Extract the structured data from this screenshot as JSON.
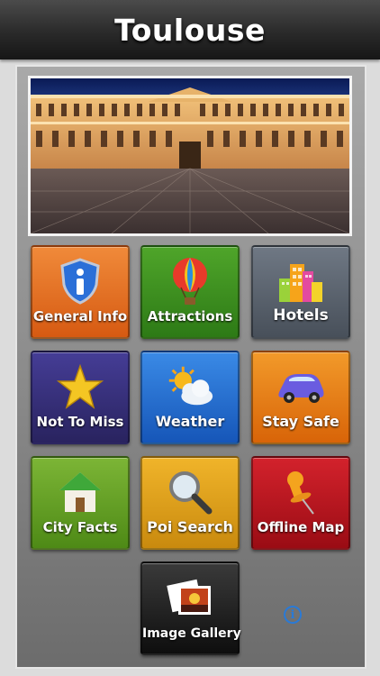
{
  "app": {
    "title": "Toulouse"
  },
  "hero": {
    "image": "toulouse-capitole-night-photo"
  },
  "tiles": [
    {
      "label": "General Info",
      "icon": "shield-info-icon",
      "color": "#e26a22"
    },
    {
      "label": "Attractions",
      "icon": "hot-air-balloon-icon",
      "color": "#3f8f1f"
    },
    {
      "label": "Hotels",
      "icon": "buildings-icon",
      "color": "#5b6470"
    },
    {
      "label": "Not To Miss",
      "icon": "star-icon",
      "color": "#352f7a"
    },
    {
      "label": "Weather",
      "icon": "sun-cloud-icon",
      "color": "#1e6fd0"
    },
    {
      "label": "Stay Safe",
      "icon": "car-icon",
      "color": "#e67a12"
    },
    {
      "label": "City Facts",
      "icon": "house-icon",
      "color": "#6aa02a"
    },
    {
      "label": "Poi Search",
      "icon": "magnifier-icon",
      "color": "#e0a016"
    },
    {
      "label": "Offline Map",
      "icon": "pushpin-icon",
      "color": "#b8141c"
    },
    {
      "label": "Image Gallery",
      "icon": "photos-icon",
      "color": "#222222"
    }
  ],
  "info_button": {
    "glyph": "i"
  }
}
